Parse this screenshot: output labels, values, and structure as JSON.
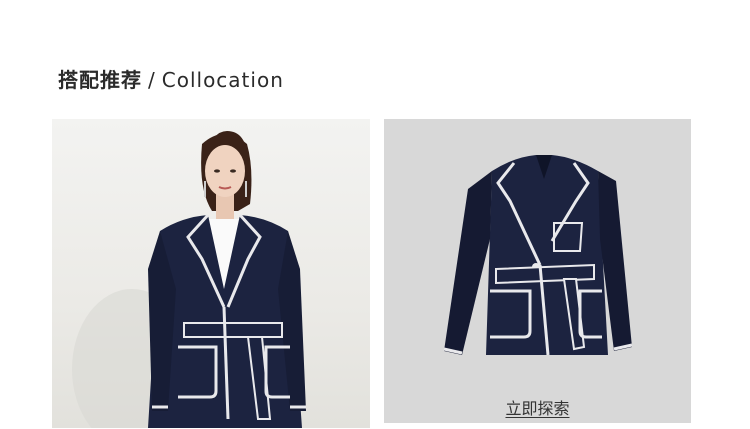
{
  "section": {
    "title_cn": "搭配推荐",
    "separator": "/",
    "title_en": "Collocation"
  },
  "model_image": {
    "icon": "model-photo"
  },
  "product_image": {
    "icon": "jacket-photo"
  },
  "explore": {
    "label": "立即探索"
  },
  "colors": {
    "navy": "#1c2340",
    "piping": "#e9e9ec",
    "grey_panel": "#d8d8d8"
  }
}
